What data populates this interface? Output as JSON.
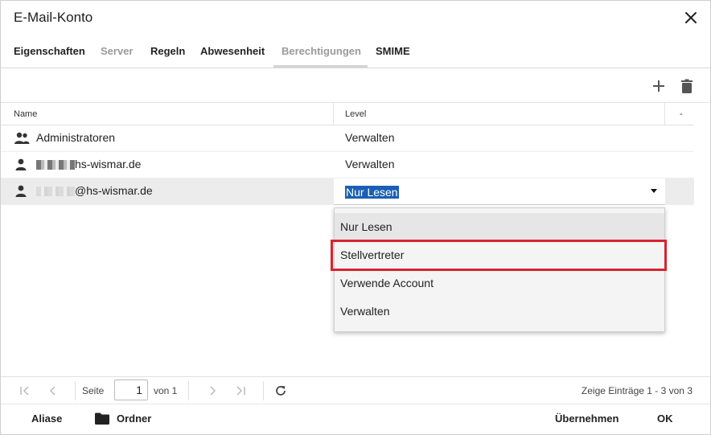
{
  "dialog": {
    "title": "E-Mail-Konto"
  },
  "tabs": [
    {
      "label": "Eigenschaften",
      "enabled": true
    },
    {
      "label": "Server",
      "enabled": false
    },
    {
      "label": "Regeln",
      "enabled": true
    },
    {
      "label": "Abwesenheit",
      "enabled": true
    },
    {
      "label": "Berechtigungen",
      "enabled": false,
      "active": true
    },
    {
      "label": "SMIME",
      "enabled": true
    }
  ],
  "toolbar": {
    "add_icon": "plus-icon",
    "delete_icon": "trash-icon"
  },
  "grid": {
    "columns": [
      "Name",
      "Level",
      "-"
    ],
    "rows": [
      {
        "icon": "group-icon",
        "name": "Administratoren",
        "level": "Verwalten"
      },
      {
        "icon": "person-icon",
        "name_suffix": "hs-wismar.de",
        "level": "Verwalten"
      },
      {
        "icon": "person-icon",
        "name_suffix": "@hs-wismar.de",
        "level": "Nur Lesen",
        "selected": true
      }
    ]
  },
  "level_dropdown": {
    "value": "Nur Lesen",
    "options": [
      "Nur Lesen",
      "Stellvertreter",
      "Verwende Account",
      "Verwalten"
    ],
    "highlighted": "Stellvertreter"
  },
  "pager": {
    "page_label": "Seite",
    "page_value": "1",
    "of_label": "von 1",
    "summary": "Zeige Einträge 1 - 3 von 3"
  },
  "footer": {
    "aliases": "Aliase",
    "folders": "Ordner",
    "apply": "Übernehmen",
    "ok": "OK"
  },
  "colors": {
    "highlight_border": "#d9232e",
    "selection": "#1a5fb4"
  }
}
